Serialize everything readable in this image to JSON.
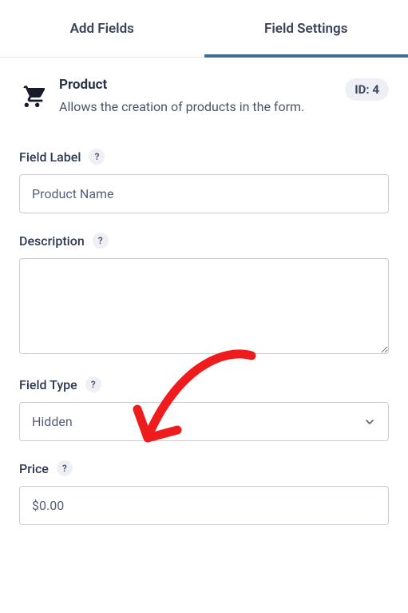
{
  "tabs": {
    "add_fields": "Add Fields",
    "field_settings": "Field Settings"
  },
  "header": {
    "title": "Product",
    "description": "Allows the creation of products in the form.",
    "id_badge": "ID: 4"
  },
  "fields": {
    "label": {
      "label": "Field Label",
      "value": "Product Name"
    },
    "description": {
      "label": "Description",
      "value": ""
    },
    "type": {
      "label": "Field Type",
      "value": "Hidden"
    },
    "price": {
      "label": "Price",
      "value": "$0.00"
    }
  },
  "help_glyph": "?"
}
